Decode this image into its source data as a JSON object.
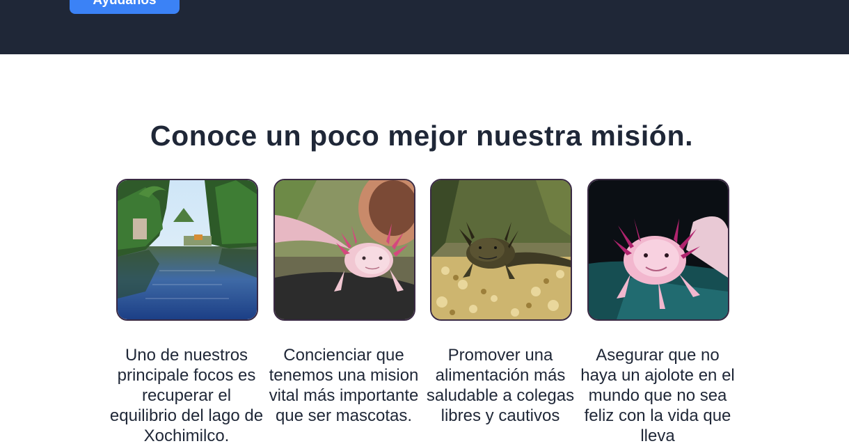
{
  "header": {
    "cta_label": "Ayúdanos",
    "background_color": "#1f2737",
    "button_color": "#3b82f6"
  },
  "mission": {
    "title": "Conoce un poco mejor nuestra misión.",
    "cards": [
      {
        "image_icon": "xochimilco-canal-photo",
        "text": "Uno de nuestros principale focos es recuperar el equilibrio del lago de Xochimilco."
      },
      {
        "image_icon": "pink-axolotl-photo",
        "text": "Concienciar que tenemos una mision vital más importante que ser mascotas."
      },
      {
        "image_icon": "dark-axolotl-on-gravel-photo",
        "text": "Promover una alimentación más saludable a colegas libres y cautivos"
      },
      {
        "image_icon": "pink-axolotl-dark-background-photo",
        "text": "Asegurar que no haya un ajolote en el mundo que no sea feliz con la vida que lleva"
      }
    ]
  }
}
